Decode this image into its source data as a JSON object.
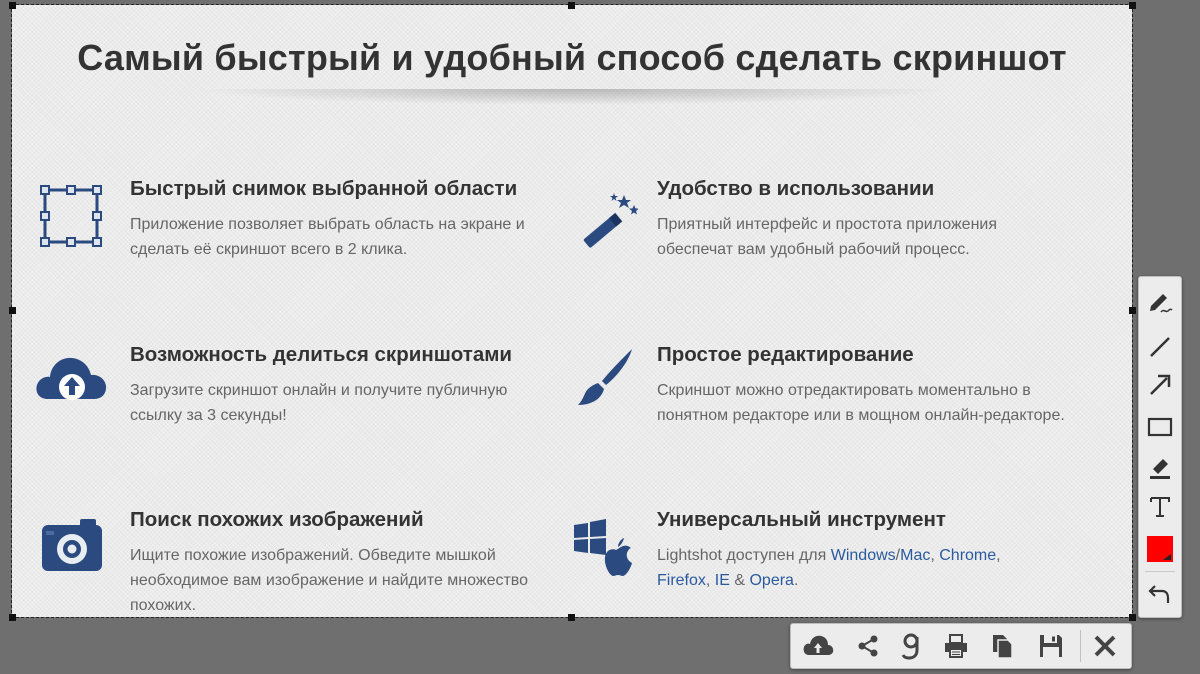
{
  "page": {
    "title": "Самый быстрый и удобный способ сделать скриншот"
  },
  "features": [
    {
      "title": "Быстрый снимок выбранной области",
      "text": "Приложение позволяет выбрать область на экране и сделать её скриншот всего в 2 клика.",
      "icon": "selection-area-icon"
    },
    {
      "title": "Удобство в использовании",
      "text": "Приятный интерфейс и простота приложения обеспечат вам удобный рабочий процесс.",
      "icon": "magic-wand-icon"
    },
    {
      "title": "Возможность делиться скриншотами",
      "text": "Загрузите скриншот онлайн и получите публичную ссылку за 3 секунды!",
      "icon": "cloud-upload-icon"
    },
    {
      "title": "Простое редактирование",
      "text": "Скриншот можно отредактировать моментально в понятном редакторе или в мощном онлайн-редакторе.",
      "icon": "paint-brush-icon"
    },
    {
      "title": "Поиск похожих изображений",
      "text": "Ищите похожие изображений. Обведите мышкой необходимое вам изображение и найдите множество похожих.",
      "icon": "camera-icon"
    },
    {
      "title": "Универсальный инструмент",
      "icon": "windows-apple-icon",
      "text_parts": {
        "prefix": "Lightshot доступен для ",
        "windows": "Windows",
        "slash": "/",
        "mac": "Mac",
        "comma1": ", ",
        "chrome": "Chrome",
        "comma2": ",",
        "firefox": "Firefox",
        "comma3": ", ",
        "ie": "IE",
        "amp": " & ",
        "opera": "Opera",
        "end": "."
      }
    }
  ],
  "toolbar_right": [
    "pen-icon",
    "line-icon",
    "arrow-icon",
    "rectangle-icon",
    "marker-icon",
    "text-icon",
    "color-picker-icon",
    "undo-icon"
  ],
  "toolbar_bottom": [
    "upload-cloud-icon",
    "share-icon",
    "google-search-icon",
    "print-icon",
    "copy-icon",
    "save-icon",
    "close-icon"
  ],
  "colors": {
    "accent": "#2a4a80",
    "link": "#2a5a9e",
    "selected_color": "#ff0000",
    "background_dim": "#6f6f6f"
  }
}
